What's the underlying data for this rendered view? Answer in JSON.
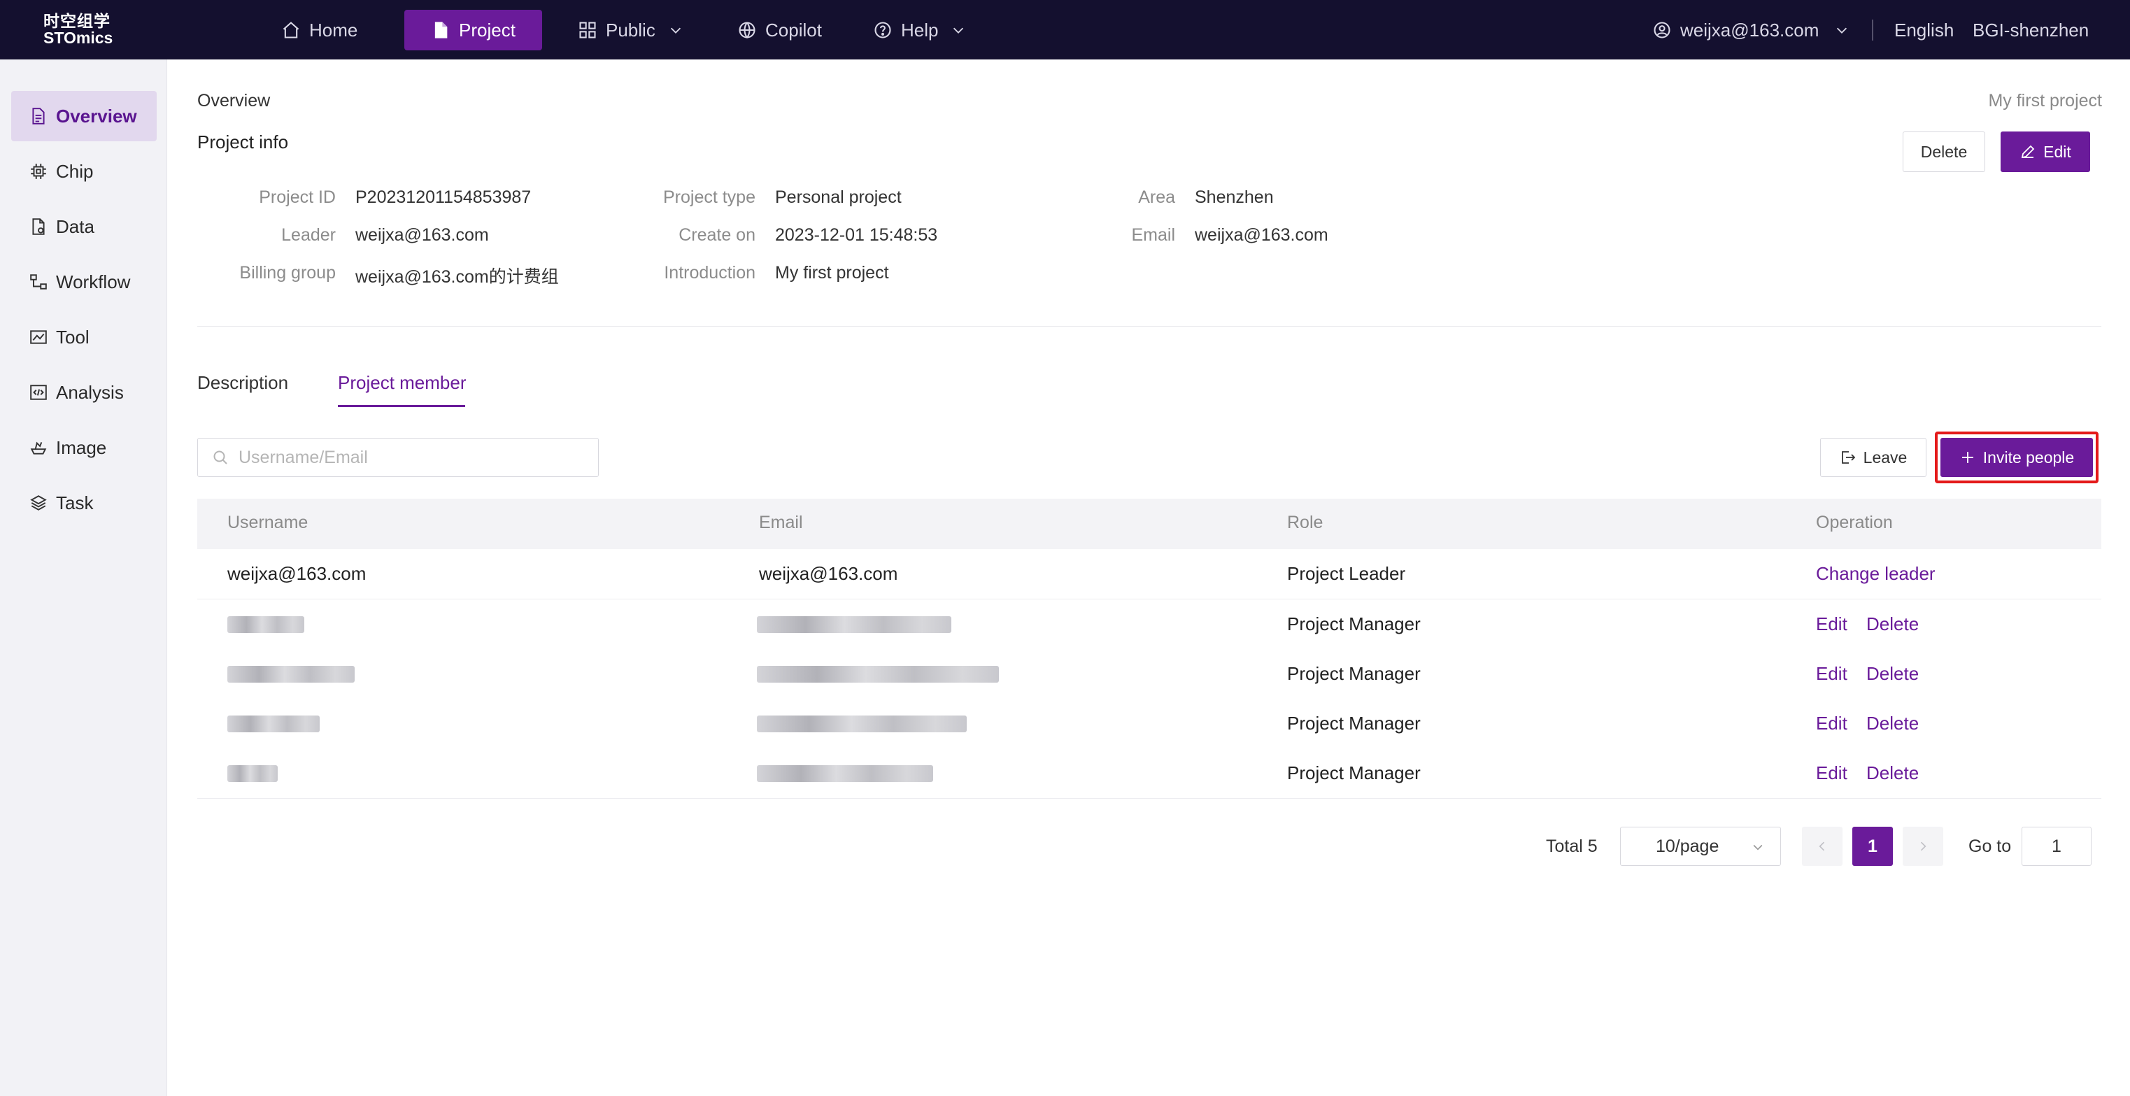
{
  "header": {
    "logo_cn": "时空组学",
    "logo_en": "STOmics",
    "nav": [
      {
        "label": "Home",
        "icon": "home-icon"
      },
      {
        "label": "Project",
        "icon": "document-icon"
      },
      {
        "label": "Public",
        "icon": "grid-icon"
      },
      {
        "label": "Copilot",
        "icon": "globe-icon"
      },
      {
        "label": "Help",
        "icon": "help-icon"
      }
    ],
    "user": "weijxa@163.com",
    "language": "English",
    "region": "BGI-shenzhen"
  },
  "sidebar": {
    "items": [
      {
        "label": "Overview",
        "icon": "document-icon"
      },
      {
        "label": "Chip",
        "icon": "chip-icon"
      },
      {
        "label": "Data",
        "icon": "file-icon"
      },
      {
        "label": "Workflow",
        "icon": "workflow-icon"
      },
      {
        "label": "Tool",
        "icon": "tool-icon"
      },
      {
        "label": "Analysis",
        "icon": "code-icon"
      },
      {
        "label": "Image",
        "icon": "image-icon"
      },
      {
        "label": "Task",
        "icon": "layers-icon"
      }
    ]
  },
  "page": {
    "breadcrumb": "Overview",
    "project_name": "My first project",
    "section_title": "Project info",
    "delete_label": "Delete",
    "edit_label": "Edit"
  },
  "info": {
    "project_id_label": "Project ID",
    "project_id": "P20231201154853987",
    "leader_label": "Leader",
    "leader": "weijxa@163.com",
    "billing_label": "Billing group",
    "billing": "weijxa@163.com的计费组",
    "type_label": "Project type",
    "type": "Personal project",
    "create_label": "Create on",
    "create": "2023-12-01 15:48:53",
    "intro_label": "Introduction",
    "intro": "My first project",
    "area_label": "Area",
    "area": "Shenzhen",
    "email_label": "Email",
    "email": "weijxa@163.com"
  },
  "tabs": [
    {
      "label": "Description"
    },
    {
      "label": "Project member"
    }
  ],
  "members": {
    "search_placeholder": "Username/Email",
    "leave_label": "Leave",
    "invite_label": "Invite people",
    "columns": [
      "Username",
      "Email",
      "Role",
      "Operation"
    ],
    "rows": [
      {
        "username": "weijxa@163.com",
        "email": "weijxa@163.com",
        "role": "Project Leader",
        "op1": "Change leader",
        "op2": ""
      },
      {
        "username": "",
        "email": "",
        "role": "Project Manager",
        "op1": "Edit",
        "op2": "Delete"
      },
      {
        "username": "",
        "email": "",
        "role": "Project Manager",
        "op1": "Edit",
        "op2": "Delete"
      },
      {
        "username": "",
        "email": "",
        "role": "Project Manager",
        "op1": "Edit",
        "op2": "Delete"
      },
      {
        "username": "",
        "email": "",
        "role": "Project Manager",
        "op1": "Edit",
        "op2": "Delete"
      }
    ]
  },
  "pagination": {
    "total": "Total 5",
    "page_size": "10/page",
    "current": "1",
    "goto_label": "Go to",
    "goto_value": "1"
  },
  "colors": {
    "accent": "#6a1b9a",
    "header_bg": "#14102f",
    "highlight": "#e41a1a"
  }
}
